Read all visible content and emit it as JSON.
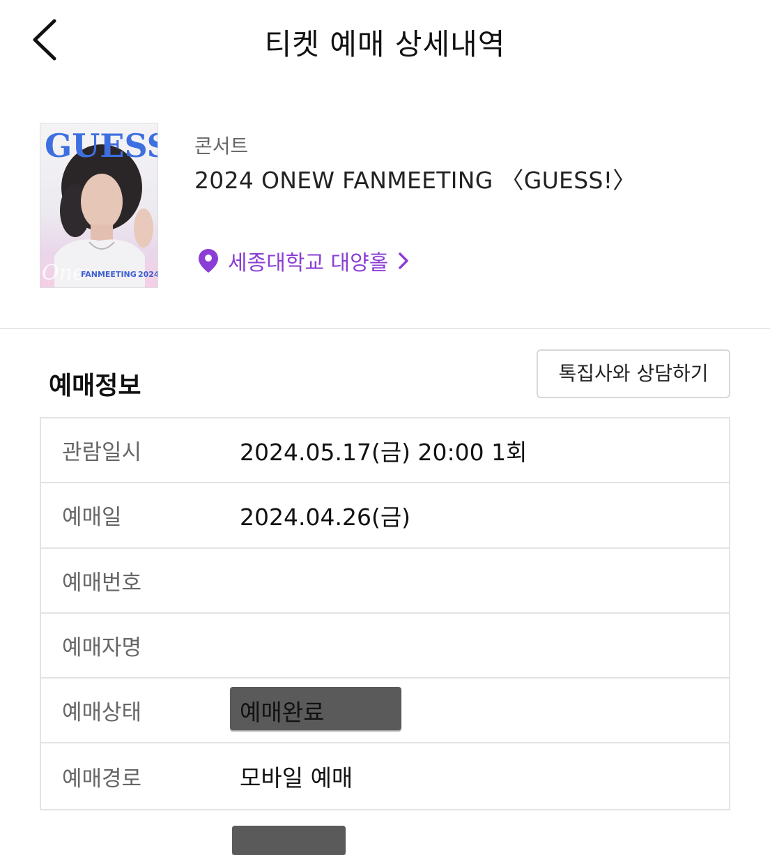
{
  "header": {
    "title": "티켓 예매 상세내역",
    "back_icon": "chevron-left-icon"
  },
  "event": {
    "category": "콘서트",
    "title": "2024 ONEW FANMEETING 〈GUESS!〉",
    "venue": "세종대학교 대양홀",
    "venue_icon": "location-pin-icon",
    "accent_color": "#8b3ed6",
    "poster": {
      "headline": "GUESS!",
      "script": "Onew",
      "banner": "FANMEETING",
      "year": "2024"
    }
  },
  "booking_section": {
    "title": "예매정보",
    "consult_button": "톡집사와 상담하기",
    "rows": [
      {
        "label": "관람일시",
        "value": "2024.05.17(금) 20:00 1회"
      },
      {
        "label": "예매일",
        "value": "2024.04.26(금)"
      },
      {
        "label": "예매번호",
        "value": ""
      },
      {
        "label": "예매자명",
        "value": ""
      },
      {
        "label": "예매상태",
        "value": "예매완료"
      },
      {
        "label": "예매경로",
        "value": "모바일 예매"
      }
    ]
  }
}
